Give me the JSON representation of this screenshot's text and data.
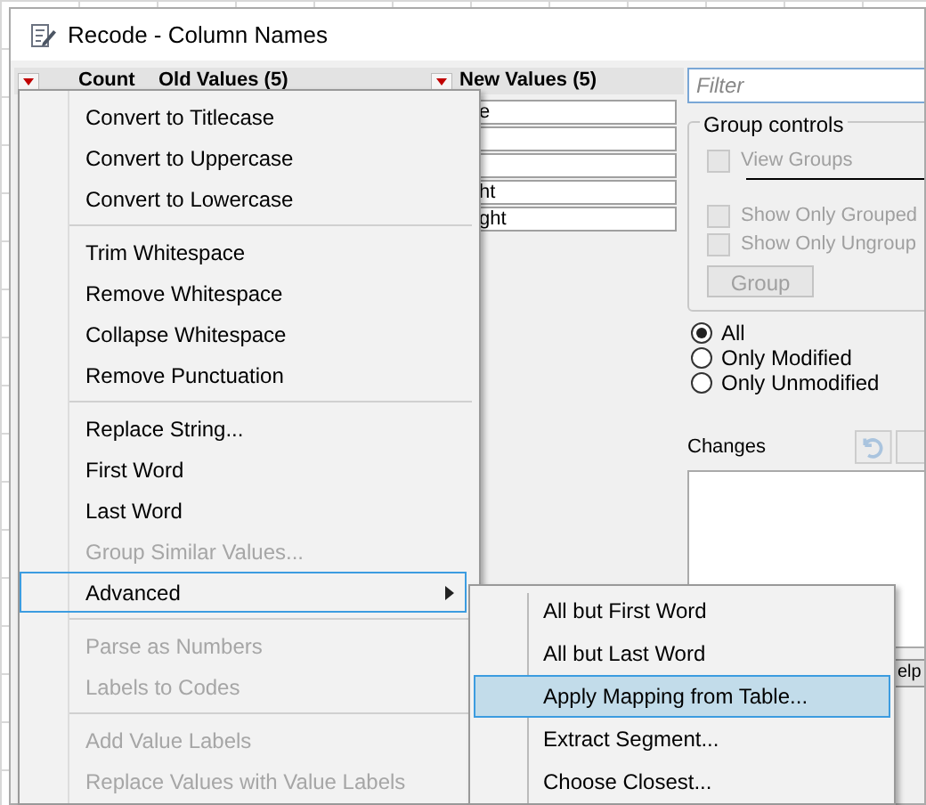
{
  "window": {
    "title": "Recode - Column Names"
  },
  "table": {
    "columns": [
      "Count",
      "Old Values (5)",
      "New Values (5)"
    ],
    "new_values": [
      {
        "kind": "field",
        "value": "e"
      },
      {
        "kind": "field"
      },
      {
        "kind": "field"
      },
      {
        "kind": "field",
        "value": "ht"
      },
      {
        "kind": "field",
        "value": "ght"
      }
    ]
  },
  "filter": {
    "placeholder": "Filter"
  },
  "group_controls": {
    "title": "Group controls",
    "checkboxes": [
      {
        "label": "View Groups",
        "checked": false,
        "disabled": true
      },
      {
        "label": "Show Only Grouped",
        "checked": false,
        "disabled": true
      },
      {
        "label": "Show Only Ungroup",
        "checked": false,
        "disabled": true
      }
    ],
    "button": "Group"
  },
  "show_options": [
    {
      "label": "All",
      "selected": true
    },
    {
      "label": "Only Modified",
      "selected": false
    },
    {
      "label": "Only Unmodified",
      "selected": false
    }
  ],
  "changes": {
    "label": "Changes"
  },
  "help_button": "elp",
  "menu": [
    {
      "kind": "item",
      "label": "Convert to Titlecase",
      "disabled": false,
      "selected": false
    },
    {
      "kind": "item",
      "label": "Convert to Uppercase",
      "disabled": false,
      "selected": false
    },
    {
      "kind": "item",
      "label": "Convert to Lowercase",
      "disabled": false,
      "selected": false
    },
    {
      "kind": "separator"
    },
    {
      "kind": "item",
      "label": "Trim Whitespace",
      "disabled": false,
      "selected": false
    },
    {
      "kind": "item",
      "label": "Remove Whitespace",
      "disabled": false,
      "selected": false
    },
    {
      "kind": "item",
      "label": "Collapse Whitespace",
      "disabled": false,
      "selected": false
    },
    {
      "kind": "item",
      "label": "Remove Punctuation",
      "disabled": false,
      "selected": false
    },
    {
      "kind": "separator"
    },
    {
      "kind": "item",
      "label": "Replace String...",
      "disabled": false,
      "selected": false
    },
    {
      "kind": "item",
      "label": "First Word",
      "disabled": false,
      "selected": false
    },
    {
      "kind": "item",
      "label": "Last Word",
      "disabled": false,
      "selected": false
    },
    {
      "kind": "item",
      "label": "Group Similar Values...",
      "disabled": true,
      "selected": false
    },
    {
      "kind": "submenu",
      "label": "Advanced",
      "disabled": false,
      "selected": true
    },
    {
      "kind": "separator"
    },
    {
      "kind": "item",
      "label": "Parse as Numbers",
      "disabled": true,
      "selected": false
    },
    {
      "kind": "item",
      "label": "Labels to Codes",
      "disabled": true,
      "selected": false
    },
    {
      "kind": "separator"
    },
    {
      "kind": "item",
      "label": "Add Value Labels",
      "disabled": true,
      "selected": false
    },
    {
      "kind": "item",
      "label": "Replace Values with Value Labels",
      "disabled": true,
      "selected": false
    }
  ],
  "submenu": [
    {
      "label": "All but First Word",
      "selected": false
    },
    {
      "label": "All but Last Word",
      "selected": false
    },
    {
      "label": "Apply Mapping from Table...",
      "selected": true
    },
    {
      "label": "Extract Segment...",
      "selected": false
    },
    {
      "label": "Choose Closest...",
      "selected": false
    }
  ]
}
